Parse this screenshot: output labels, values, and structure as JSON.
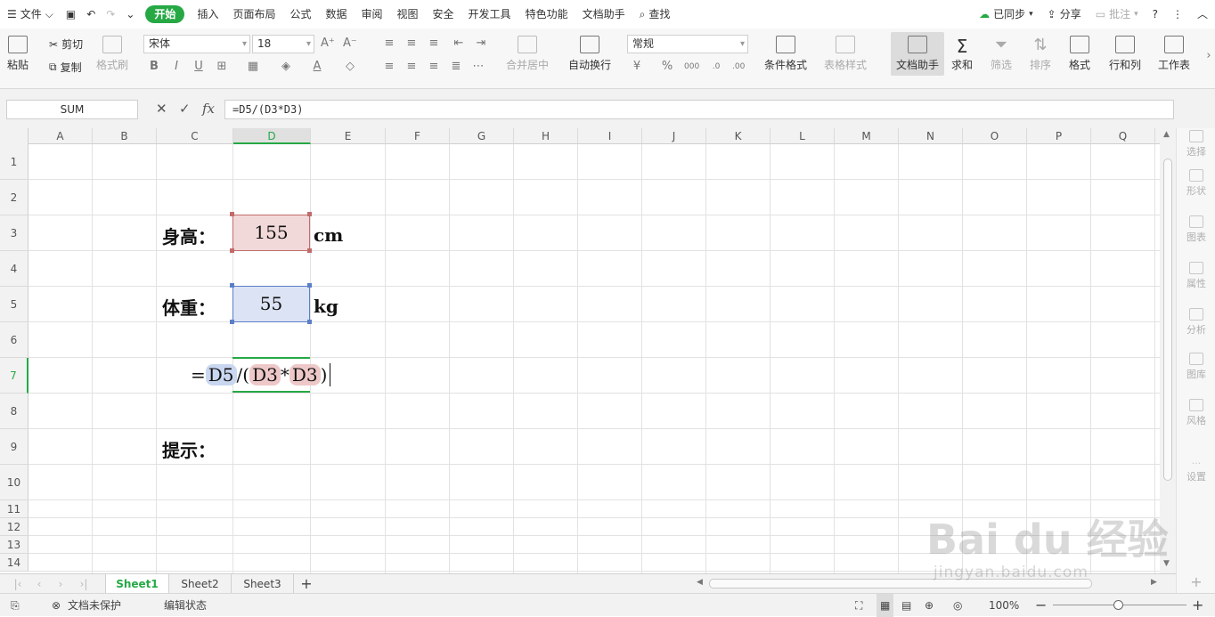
{
  "menu": {
    "file": "文件",
    "tabs": [
      "开始",
      "插入",
      "页面布局",
      "公式",
      "数据",
      "审阅",
      "视图",
      "安全",
      "开发工具",
      "特色功能",
      "文档助手"
    ],
    "search": "查找",
    "sync": "已同步",
    "share": "分享",
    "comment": "批注"
  },
  "ribbon": {
    "paste": "粘贴",
    "cut": "剪切",
    "copy": "复制",
    "format_painter": "格式刷",
    "font": "宋体",
    "font_size": "18",
    "merge": "合并居中",
    "wrap": "自动换行",
    "number_format": "常规",
    "cond_format": "条件格式",
    "table_style": "表格样式",
    "doc_helper": "文档助手",
    "sum": "求和",
    "filter": "筛选",
    "sort": "排序",
    "format": "格式",
    "rowcol": "行和列",
    "sheet": "工作表"
  },
  "formula_bar": {
    "name_box": "SUM",
    "formula": "=D5/(D3*D3)",
    "fx": "fx"
  },
  "columns": [
    "A",
    "B",
    "C",
    "D",
    "E",
    "F",
    "G",
    "H",
    "I",
    "J",
    "K",
    "L",
    "M",
    "N",
    "O",
    "P",
    "Q"
  ],
  "rows": [
    "1",
    "2",
    "3",
    "4",
    "5",
    "6",
    "7",
    "8",
    "9",
    "10",
    "11",
    "12",
    "13",
    "14"
  ],
  "cells": {
    "c3": "身高：",
    "d3": "155",
    "e3": "cm",
    "c5": "体重：",
    "d5": "55",
    "e5": "kg",
    "c9": "提示："
  },
  "editing": {
    "eq": "=",
    "ref1": "D5",
    "op1": "/(",
    "ref2": "D3",
    "op2": "*",
    "ref3": "D3",
    "close": ")"
  },
  "sheets": [
    "Sheet1",
    "Sheet2",
    "Sheet3"
  ],
  "side_panel": [
    "选择",
    "形状",
    "图表",
    "属性",
    "分析",
    "图库",
    "风格",
    "设置"
  ],
  "status": {
    "protect": "文档未保护",
    "mode": "编辑状态",
    "zoom": "100%"
  },
  "watermark": {
    "brand": "Bai du 经验",
    "url": "jingyan.baidu.com"
  }
}
